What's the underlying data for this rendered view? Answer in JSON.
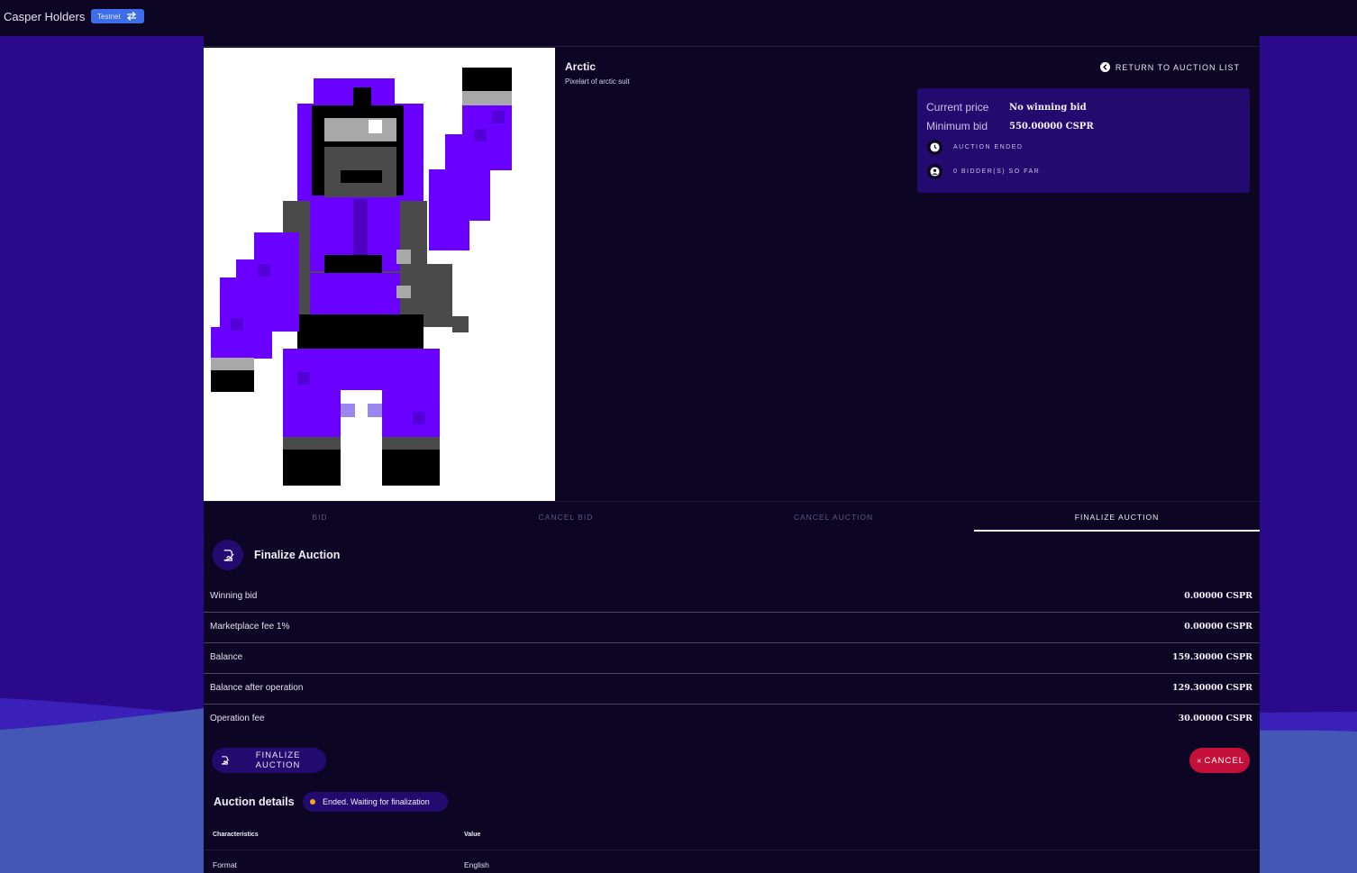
{
  "header": {
    "app_title": "Casper Holders",
    "network_badge": "Testnet",
    "network_icon": "swap-arrows-icon"
  },
  "item": {
    "name": "Arctic",
    "description": "Pixelart of arctic suit",
    "return_link": "RETURN TO AUCTION LIST"
  },
  "price_card": {
    "current_price_label": "Current price",
    "current_price_value": "No winning bid",
    "minimum_bid_label": "Minimum bid",
    "minimum_bid_value": "550.00000 CSPR",
    "auction_status": "AUCTION ENDED",
    "bidders": "0 BIDDER(S) SO FAR"
  },
  "tabs": [
    {
      "label": "BID",
      "active": false
    },
    {
      "label": "CANCEL BID",
      "active": false
    },
    {
      "label": "CANCEL AUCTION",
      "active": false
    },
    {
      "label": "FINALIZE AUCTION",
      "active": true
    }
  ],
  "finalize": {
    "title": "Finalize Auction",
    "rows": [
      {
        "label": "Winning bid",
        "value": "0.00000 CSPR"
      },
      {
        "label": "Marketplace fee 1%",
        "value": "0.00000 CSPR"
      },
      {
        "label": "Balance",
        "value": "159.30000 CSPR"
      },
      {
        "label": "Balance after operation",
        "value": "129.30000 CSPR"
      },
      {
        "label": "Operation fee",
        "value": "30.00000 CSPR"
      }
    ],
    "finalize_button": "FINALIZE AUCTION",
    "cancel_button": "CANCEL"
  },
  "details": {
    "title": "Auction details",
    "status": "Ended. Waiting for finalization",
    "status_color": "#f5a623",
    "columns": [
      "Characteristics",
      "Value"
    ],
    "rows": [
      {
        "characteristic": "Format",
        "value": "English"
      }
    ]
  },
  "colors": {
    "accent_purple": "#230a6e",
    "panel_bg": "#0c0524",
    "cancel_red": "#c4103a",
    "badge_blue": "#3d6de8"
  }
}
